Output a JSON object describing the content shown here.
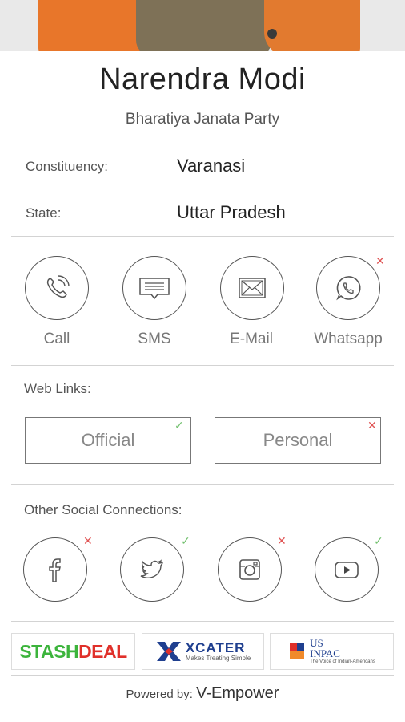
{
  "profile": {
    "name": "Narendra Modi",
    "party": "Bharatiya Janata Party"
  },
  "details": {
    "constituency_label": "Constituency:",
    "constituency_value": "Varanasi",
    "state_label": "State:",
    "state_value": "Uttar Pradesh"
  },
  "contact": [
    {
      "label": "Call",
      "icon": "phone-icon",
      "status": null
    },
    {
      "label": "SMS",
      "icon": "message-icon",
      "status": null
    },
    {
      "label": "E-Mail",
      "icon": "envelope-icon",
      "status": null
    },
    {
      "label": "Whatsapp",
      "icon": "whatsapp-icon",
      "status": "unavailable"
    }
  ],
  "web_links": {
    "label": "Web Links:",
    "official": "Official",
    "official_status": "available",
    "personal": "Personal",
    "personal_status": "unavailable"
  },
  "social": {
    "label": "Other Social Connections:",
    "items": [
      {
        "icon": "facebook-icon",
        "status": "unavailable"
      },
      {
        "icon": "twitter-icon",
        "status": "available"
      },
      {
        "icon": "instagram-icon",
        "status": "unavailable"
      },
      {
        "icon": "youtube-icon",
        "status": "available"
      }
    ]
  },
  "sponsors": {
    "stashdeal_part1": "STASH",
    "stashdeal_part2": "DEAL",
    "xcater_name": "XCATER",
    "xcater_tagline": "Makes Treating Simple",
    "usinpac_line1": "US",
    "usinpac_line2": "INPAC",
    "usinpac_tagline": "The Voice of Indian-Americans"
  },
  "footer": {
    "powered_by": "Powered by:",
    "brand": "V-Empower"
  },
  "colors": {
    "unavailable_mark": "#e05555",
    "available_mark": "#72c06e",
    "stash_green": "#3cb43c",
    "deal_red": "#e0302a",
    "xcater_blue": "#1f3f8f"
  }
}
